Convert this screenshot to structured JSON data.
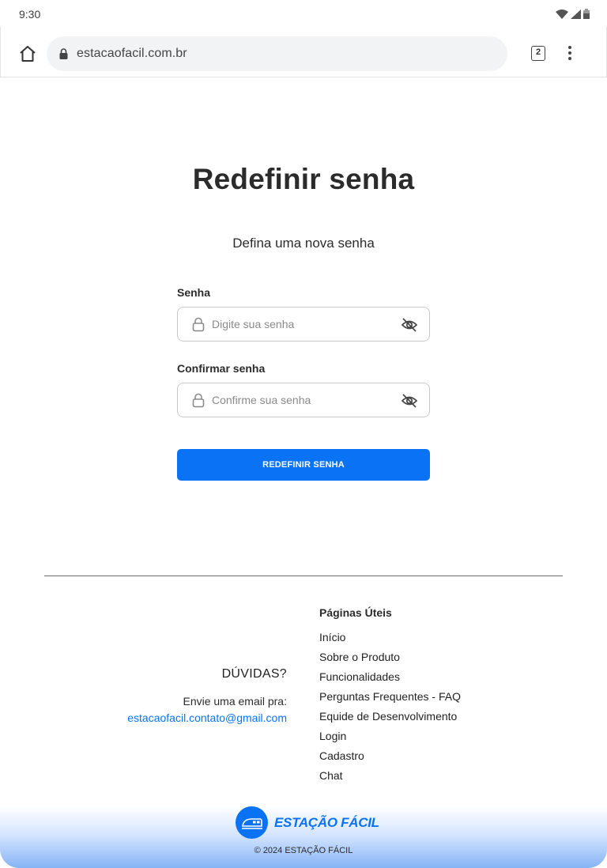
{
  "status_bar": {
    "time": "9:30"
  },
  "browser": {
    "url": "estacaofacil.com.br",
    "tab_count": "2"
  },
  "main": {
    "title": "Redefinir senha",
    "subtitle": "Defina uma nova senha",
    "password": {
      "label": "Senha",
      "placeholder": "Digite sua senha"
    },
    "confirm": {
      "label": "Confirmar senha",
      "placeholder": "Confirme sua senha"
    },
    "submit_label": "REDEFINIR SENHA"
  },
  "footer": {
    "duvidas": "DÚVIDAS?",
    "envie": "Envie uma email pra:",
    "email": "estacaofacil.contato@gmail.com",
    "links_title": "Páginas Úteis",
    "links": [
      "Início",
      "Sobre o Produto",
      "Funcionalidades",
      "Perguntas Frequentes - FAQ",
      "Equide de Desenvolvimento",
      "Login",
      "Cadastro",
      "Chat"
    ],
    "brand": "ESTAÇÃO FÁCIL",
    "copyright": "© 2024 ESTAÇÃO FÁCIL"
  },
  "colors": {
    "accent": "#0a73f5",
    "text": "#2b2b2b"
  },
  "icons": [
    "wifi-icon",
    "signal-icon",
    "battery-icon",
    "home-icon",
    "lock-icon",
    "eye-off-icon",
    "train-icon"
  ]
}
